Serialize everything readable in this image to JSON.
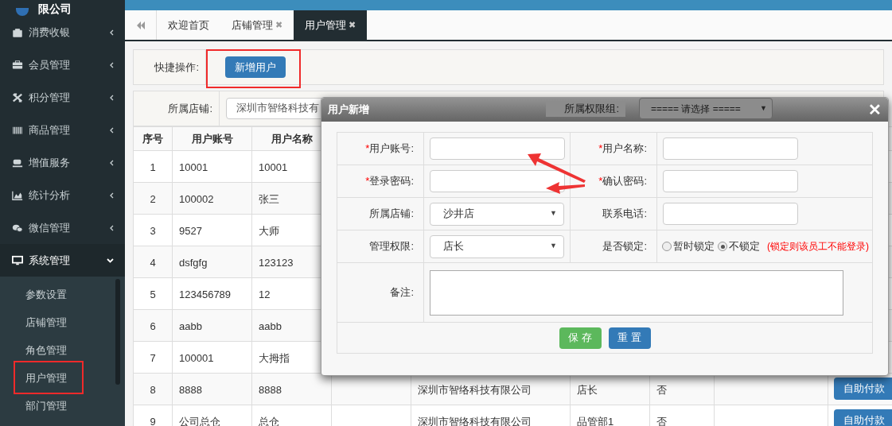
{
  "logo": {
    "text": "限公司"
  },
  "sidebar": {
    "items": [
      {
        "label": "消费收银",
        "expanded": false
      },
      {
        "label": "会员管理",
        "expanded": false
      },
      {
        "label": "积分管理",
        "expanded": false
      },
      {
        "label": "商品管理",
        "expanded": false
      },
      {
        "label": "增值服务",
        "expanded": false
      },
      {
        "label": "统计分析",
        "expanded": false
      },
      {
        "label": "微信管理",
        "expanded": false
      },
      {
        "label": "系统管理",
        "expanded": true,
        "children": [
          {
            "label": "参数设置"
          },
          {
            "label": "店铺管理"
          },
          {
            "label": "角色管理"
          },
          {
            "label": "用户管理"
          },
          {
            "label": "部门管理"
          }
        ]
      }
    ]
  },
  "tabs": [
    {
      "label": "欢迎首页",
      "closable": false,
      "selected": false
    },
    {
      "label": "店铺管理",
      "closable": true,
      "selected": false
    },
    {
      "label": "用户管理",
      "closable": true,
      "selected": true
    }
  ],
  "tab_close_glyph": "✖",
  "quick_actions": {
    "label": "快捷操作:",
    "button": "新增用户"
  },
  "filters": [
    {
      "label": "所属店铺:",
      "value": "深圳市智络科技有"
    },
    {
      "label": "所属权限组:",
      "value": "===== 请选择 =====",
      "caret": "▼"
    }
  ],
  "table": {
    "columns": [
      "序号",
      "用户账号",
      "用户名称"
    ],
    "rows": [
      {
        "cells": [
          "1",
          "10001",
          "10001"
        ]
      },
      {
        "cells": [
          "2",
          "100002",
          "张三"
        ]
      },
      {
        "cells": [
          "3",
          "9527",
          "大师"
        ]
      },
      {
        "cells": [
          "4",
          "dsfgfg",
          "123123"
        ]
      },
      {
        "cells": [
          "5",
          "123456789",
          "12"
        ]
      },
      {
        "cells": [
          "6",
          "aabb",
          "aabb"
        ]
      },
      {
        "cells": [
          "7",
          "100001",
          "大拇指"
        ]
      },
      {
        "cells": [
          "8",
          "8888",
          "8888",
          "",
          "深圳市智络科技有限公司",
          "店长",
          "否",
          ""
        ],
        "action": "自助付款"
      },
      {
        "cells": [
          "9",
          "公司总仓",
          "总仓",
          "",
          "深圳市智络科技有限公司",
          "品管部1",
          "否",
          ""
        ],
        "action": "自助付款"
      }
    ]
  },
  "dialog": {
    "title": "用户新增",
    "close": "✕",
    "required_mark": "*",
    "select_caret": "▼",
    "rows": [
      [
        {
          "label": "用户账号:",
          "required": true,
          "kind": "text"
        },
        {
          "label": "用户名称:",
          "required": true,
          "kind": "text"
        }
      ],
      [
        {
          "label": "登录密码:",
          "required": true,
          "kind": "text"
        },
        {
          "label": "确认密码:",
          "required": true,
          "kind": "text"
        }
      ],
      [
        {
          "label": "所属店铺:",
          "required": false,
          "kind": "select",
          "value": "沙井店"
        },
        {
          "label": "联系电话:",
          "required": false,
          "kind": "text"
        }
      ],
      [
        {
          "label": "管理权限:",
          "required": false,
          "kind": "select",
          "value": "店长"
        },
        {
          "label": "是否锁定:",
          "required": false,
          "kind": "radio",
          "options": [
            {
              "label": "暂时锁定",
              "selected": false
            },
            {
              "label": "不锁定",
              "selected": true
            }
          ],
          "note": "(锁定则该员工不能登录)"
        }
      ],
      [
        {
          "label": "备注:",
          "required": false,
          "kind": "textarea"
        }
      ]
    ],
    "buttons": [
      {
        "label": "保 存",
        "kind": "save"
      },
      {
        "label": "重 置",
        "kind": "reset"
      }
    ]
  }
}
